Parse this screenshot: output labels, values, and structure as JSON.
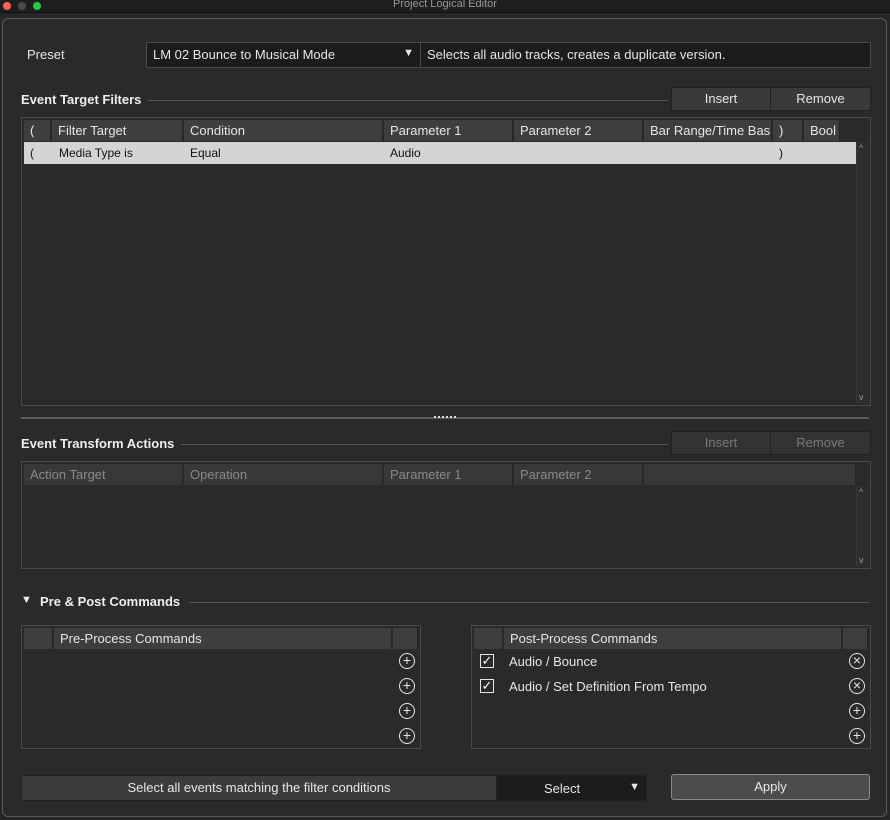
{
  "window": {
    "title": "Project Logical Editor"
  },
  "preset": {
    "label": "Preset",
    "value": "LM 02 Bounce to Musical Mode",
    "description": "Selects all audio tracks, creates a duplicate version."
  },
  "filters": {
    "title": "Event Target Filters",
    "insert_label": "Insert",
    "remove_label": "Remove",
    "columns": [
      "(",
      "Filter Target",
      "Condition",
      "Parameter 1",
      "Parameter 2",
      "Bar Range/Time Bas",
      ")",
      "Bool"
    ],
    "rows": [
      {
        "open": "(",
        "target": "Media Type is",
        "condition": "Equal",
        "param1": "Audio",
        "param2": "",
        "range": "",
        "close": ")",
        "bool": ""
      }
    ]
  },
  "actions": {
    "title": "Event Transform Actions",
    "insert_label": "Insert",
    "remove_label": "Remove",
    "columns": [
      "Action Target",
      "Operation",
      "Parameter 1",
      "Parameter 2"
    ]
  },
  "commands": {
    "title": "Pre & Post Commands",
    "pre_header": "Pre-Process Commands",
    "post_header": "Post-Process Commands",
    "post_items": [
      {
        "label": "Audio / Bounce",
        "checked": true
      },
      {
        "label": "Audio / Set Definition From Tempo",
        "checked": true
      }
    ]
  },
  "footer": {
    "description": "Select all events matching the filter conditions",
    "function_value": "Select",
    "apply_label": "Apply"
  },
  "colors": {
    "selected_row": "#d4d4d4",
    "close_dot": "#ff5f57",
    "minimize_dot": "#febc2e",
    "zoom_dot": "#28c840"
  }
}
